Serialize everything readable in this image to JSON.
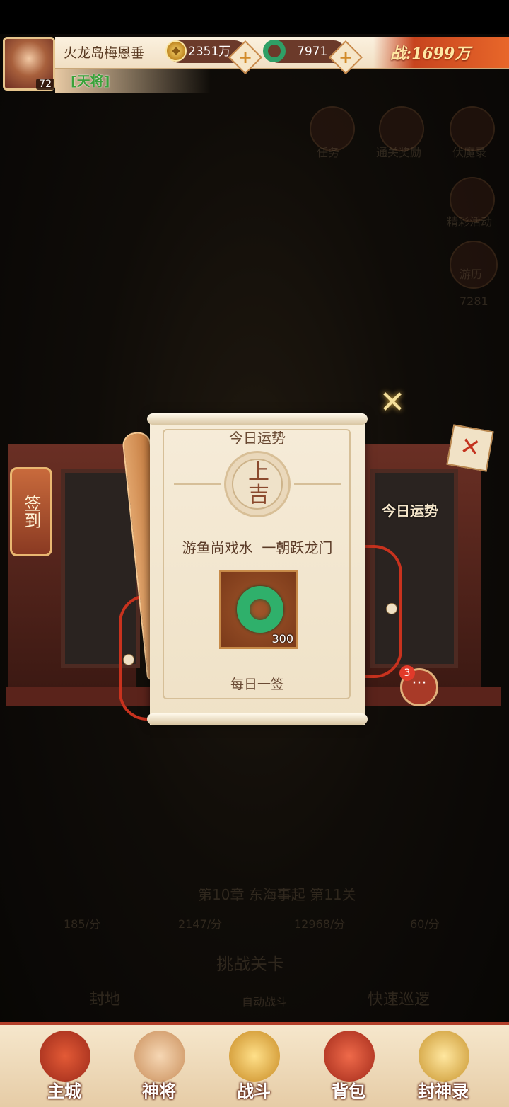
{
  "hud": {
    "player_name": "火龙岛梅恩垂",
    "level": "72",
    "rank": "[天将]",
    "gold": "2351万",
    "jade": "7971",
    "power": "战:1699万"
  },
  "popup": {
    "title": "今日运势",
    "fortune_level": "上\n吉",
    "verse": "游鱼尚戏水  一朝跃龙门",
    "reward_count": "300",
    "footer": "每日一签",
    "icon": "jade-ring-icon"
  },
  "side": {
    "sign_in": "签到",
    "today_fortune": "今日运势",
    "chat_badge": "3"
  },
  "background_labels": {
    "task": "任务",
    "clear_reward": "通关奖励",
    "quick_demon": "伏魔录",
    "event": "精彩活动",
    "travel": "游历",
    "travel_count": "7281",
    "chapter": "第10章 东海事起 第11关",
    "stat1": "185/分",
    "stat2": "2147/分",
    "stat3": "12968/分",
    "stat4": "60/分",
    "challenge": "挑战关卡",
    "auto_battle": "自动战斗",
    "fief": "封地",
    "patrol": "快速巡逻"
  },
  "nav": [
    {
      "label": "主城",
      "icon": "city-gate-icon",
      "color": "#c8462a"
    },
    {
      "label": "神将",
      "icon": "hero-portrait-icon",
      "color": "#e8b07a"
    },
    {
      "label": "战斗",
      "icon": "crossed-swords-icon",
      "color": "#e0a030"
    },
    {
      "label": "背包",
      "icon": "bag-icon",
      "color": "#c9422a"
    },
    {
      "label": "封神录",
      "icon": "golden-boat-icon",
      "color": "#d9a63a"
    }
  ]
}
